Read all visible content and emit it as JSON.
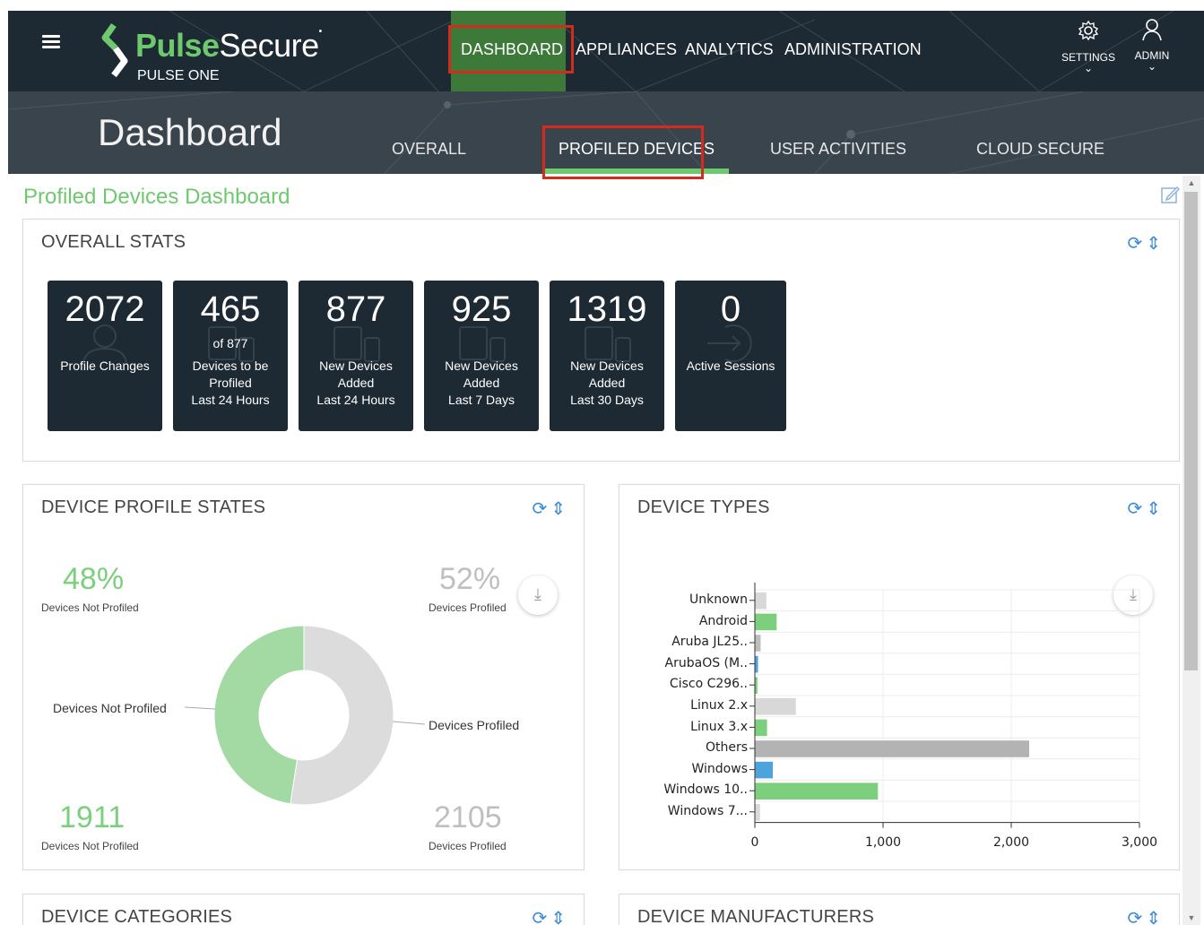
{
  "header": {
    "brand_pulse": "Pulse",
    "brand_secure": "Secure",
    "product": "PULSE ONE",
    "nav": [
      "DASHBOARD",
      "APPLIANCES",
      "ANALYTICS",
      "ADMINISTRATION"
    ],
    "settings_label": "SETTINGS",
    "admin_label": "ADMIN"
  },
  "subheader": {
    "title": "Dashboard",
    "tabs": [
      "OVERALL",
      "PROFILED DEVICES",
      "USER ACTIVITIES",
      "CLOUD SECURE"
    ],
    "active_tab": "PROFILED DEVICES"
  },
  "page": {
    "heading": "Profiled Devices Dashboard"
  },
  "overall_stats": {
    "title": "OVERALL STATS",
    "cards": [
      {
        "value": "2072",
        "sub": "",
        "lines": [
          "Profile Changes"
        ]
      },
      {
        "value": "465",
        "sub": "of 877",
        "lines": [
          "Devices to be",
          "Profiled",
          "Last 24 Hours"
        ]
      },
      {
        "value": "877",
        "sub": "",
        "lines": [
          "New Devices",
          "Added",
          "Last 24 Hours"
        ]
      },
      {
        "value": "925",
        "sub": "",
        "lines": [
          "New Devices",
          "Added",
          "Last 7 Days"
        ]
      },
      {
        "value": "1319",
        "sub": "",
        "lines": [
          "New Devices",
          "Added",
          "Last 30 Days"
        ]
      },
      {
        "value": "0",
        "sub": "",
        "lines": [
          "Active Sessions"
        ]
      }
    ]
  },
  "device_profile_states": {
    "title": "DEVICE PROFILE STATES",
    "not_profiled_pct": "48%",
    "not_profiled_pct_caption": "Devices Not Profiled",
    "profiled_pct": "52%",
    "profiled_pct_caption": "Devices Profiled",
    "not_profiled_count": "1911",
    "not_profiled_count_caption": "Devices Not Profiled",
    "profiled_count": "2105",
    "profiled_count_caption": "Devices Profiled",
    "slice_label_not_profiled": "Devices Not Profiled",
    "slice_label_profiled": "Devices Profiled"
  },
  "device_types": {
    "title": "DEVICE TYPES"
  },
  "device_categories": {
    "title": "DEVICE CATEGORIES"
  },
  "device_manufacturers": {
    "title": "DEVICE MANUFACTURERS"
  },
  "colors": {
    "green": "#6ec96e",
    "dark_header": "#1e2a33",
    "subheader": "#3a444c",
    "highlight_red": "#d42b1c",
    "accent_blue": "#3d8bd8"
  },
  "chart_data": [
    {
      "type": "pie",
      "labels": [
        "Devices Not Profiled",
        "Devices Profiled"
      ],
      "values": [
        1911,
        2105
      ],
      "colors": [
        "#a3d9a3",
        "#dcdcdc"
      ]
    },
    {
      "type": "bar",
      "orientation": "horizontal",
      "categories": [
        "Unknown",
        "Android",
        "Aruba JL25..",
        "ArubaOS (M..",
        "Cisco C296..",
        "Linux 2.x",
        "Linux 3.x",
        "Others",
        "Windows",
        "Windows 10..",
        "Windows 7..."
      ],
      "values": [
        90,
        170,
        45,
        25,
        20,
        320,
        95,
        2140,
        140,
        960,
        40
      ],
      "colors": [
        "#d8d8d8",
        "#7ccf7c",
        "#bdbdbd",
        "#4da3dc",
        "#7ccf7c",
        "#d8d8d8",
        "#7ccf7c",
        "#b3b3b3",
        "#4da3dc",
        "#7ccf7c",
        "#d8d8d8"
      ],
      "xlim": [
        0,
        3000
      ],
      "xticks": [
        "0",
        "1,000",
        "2,000",
        "3,000"
      ]
    }
  ]
}
